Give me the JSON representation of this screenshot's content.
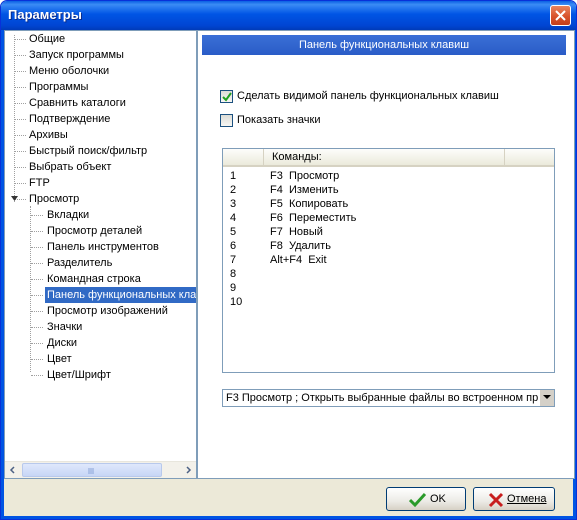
{
  "window": {
    "title": "Параметры"
  },
  "tree": {
    "items": [
      {
        "label": "Общие"
      },
      {
        "label": "Запуск программы"
      },
      {
        "label": "Меню оболочки"
      },
      {
        "label": "Программы"
      },
      {
        "label": "Сравнить каталоги"
      },
      {
        "label": "Подтверждение"
      },
      {
        "label": "Архивы"
      },
      {
        "label": "Быстрый поиск/фильтр"
      },
      {
        "label": "Выбрать объект"
      },
      {
        "label": "FTP"
      },
      {
        "label": "Просмотр",
        "expanded": true
      },
      {
        "label": "Вкладки"
      },
      {
        "label": "Просмотр деталей"
      },
      {
        "label": "Панель инструментов"
      },
      {
        "label": "Разделитель"
      },
      {
        "label": "Командная строка"
      },
      {
        "label": "Панель функциональных клавиш",
        "selected": true
      },
      {
        "label": "Просмотр изображений"
      },
      {
        "label": "Значки"
      },
      {
        "label": "Диски"
      },
      {
        "label": "Цвет"
      },
      {
        "label": "Цвет/Шрифт"
      }
    ]
  },
  "panel": {
    "header": "Панель функциональных клавиш",
    "show_fkeys": {
      "label": "Сделать видимой панель функциональных клавиш",
      "checked": true
    },
    "show_icons": {
      "label": "Показать значки",
      "checked": false
    },
    "list": {
      "col_commands": "Команды:",
      "rows": [
        {
          "num": "1",
          "cmd": "F3  Просмотр"
        },
        {
          "num": "2",
          "cmd": "F4  Изменить"
        },
        {
          "num": "3",
          "cmd": "F5  Копировать"
        },
        {
          "num": "4",
          "cmd": "F6  Переместить"
        },
        {
          "num": "5",
          "cmd": "F7  Новый"
        },
        {
          "num": "6",
          "cmd": "F8  Удалить"
        },
        {
          "num": "7",
          "cmd": "Alt+F4  Exit"
        },
        {
          "num": "8",
          "cmd": ""
        },
        {
          "num": "9",
          "cmd": ""
        },
        {
          "num": "10",
          "cmd": ""
        }
      ]
    },
    "combo_value": "F3  Просмотр ; Открыть выбранные файлы во встроенном пр"
  },
  "buttons": {
    "ok": "OK",
    "cancel": "Отмена"
  },
  "colors": {
    "titlebar": "#0054e3",
    "selection": "#316ac5",
    "panel_header": "#2f62cc",
    "ok_check": "#2a9a2a",
    "cancel_x": "#c81e1e"
  }
}
